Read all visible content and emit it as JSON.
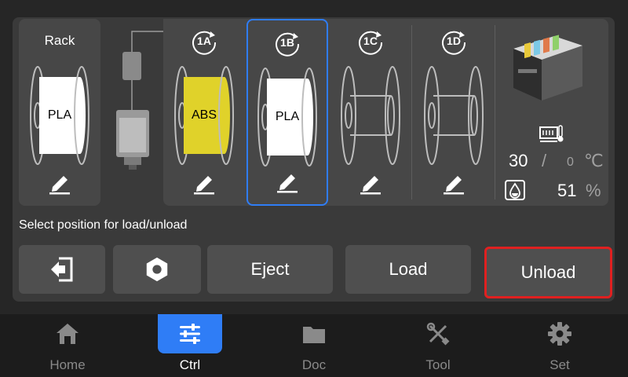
{
  "slots": {
    "rack": {
      "title": "Rack",
      "material": "PLA",
      "color": "#ffffff"
    },
    "ams": [
      {
        "id": "1A",
        "material": "ABS",
        "color": "#e0d22a",
        "selected": false,
        "empty": false
      },
      {
        "id": "1B",
        "material": "PLA",
        "color": "#ffffff",
        "selected": true,
        "empty": false
      },
      {
        "id": "1C",
        "material": "",
        "color": "",
        "selected": false,
        "empty": true
      },
      {
        "id": "1D",
        "material": "",
        "color": "",
        "selected": false,
        "empty": true
      }
    ]
  },
  "info": {
    "temp_current": "30",
    "temp_separator": "/",
    "temp_target": "0",
    "temp_unit": "℃",
    "humidity_value": "51",
    "humidity_unit": "%"
  },
  "hint": "Select position for load/unload",
  "buttons": {
    "eject": "Eject",
    "load": "Load",
    "unload": "Unload"
  },
  "nav": [
    {
      "label": "Home",
      "icon": "home-icon",
      "active": false
    },
    {
      "label": "Ctrl",
      "icon": "sliders-icon",
      "active": true
    },
    {
      "label": "Doc",
      "icon": "folder-icon",
      "active": false
    },
    {
      "label": "Tool",
      "icon": "tools-icon",
      "active": false
    },
    {
      "label": "Set",
      "icon": "gear-icon",
      "active": false
    }
  ],
  "colors": {
    "accent": "#2f7df6",
    "highlight": "#e02020",
    "panel": "#3a3a3a",
    "slot": "#474747"
  }
}
